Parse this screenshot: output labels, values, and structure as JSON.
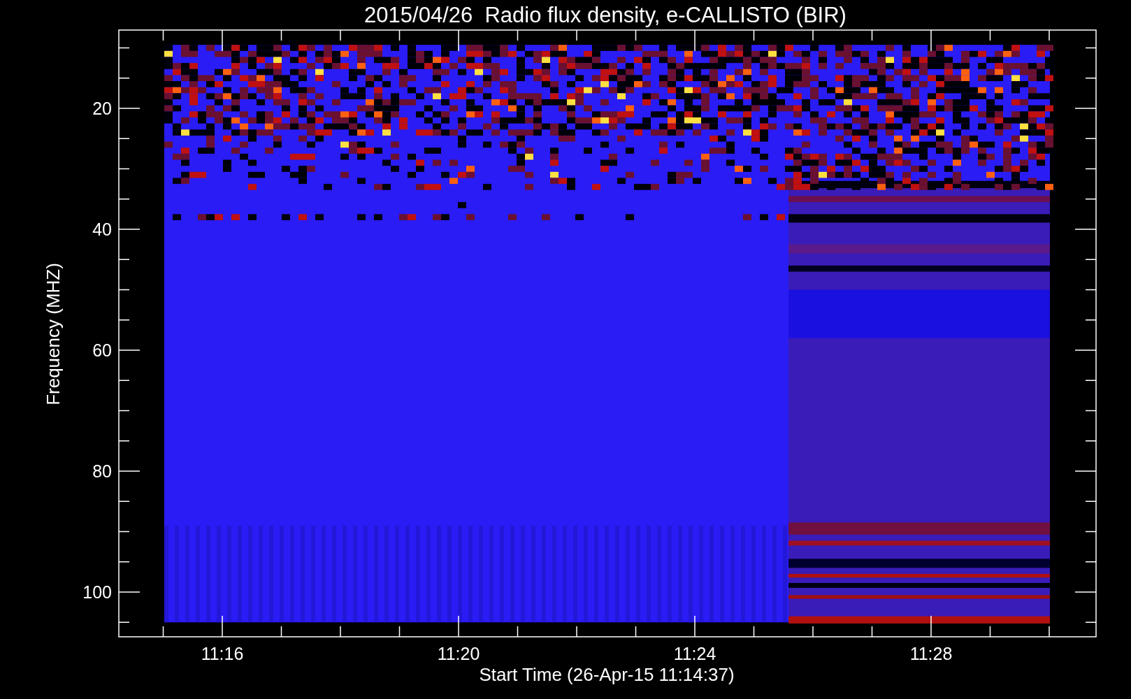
{
  "title": "2015/04/26  Radio flux density, e-CALLISTO (BIR)",
  "y_axis": {
    "label": "Frequency (MHZ)",
    "ticks": [
      "20",
      "40",
      "60",
      "80",
      "100"
    ]
  },
  "x_axis": {
    "label": "Start Time (26-Apr-15 11:14:37)",
    "ticks": [
      "11:16",
      "11:20",
      "11:24",
      "11:28"
    ]
  }
}
